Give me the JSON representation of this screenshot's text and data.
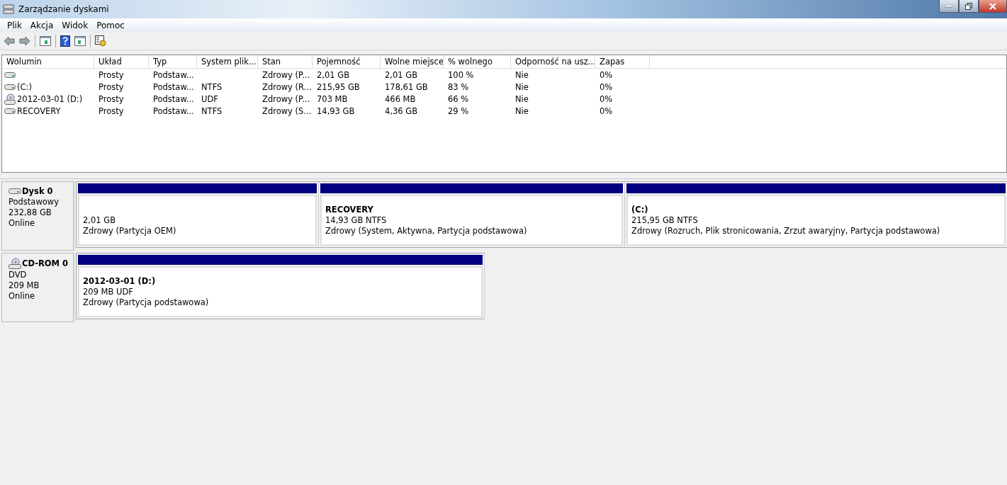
{
  "window": {
    "title": "Zarządzanie dyskami"
  },
  "menu": [
    "Plik",
    "Akcja",
    "Widok",
    "Pomoc"
  ],
  "table": {
    "columns": [
      "Wolumin",
      "Układ",
      "Typ",
      "System plik...",
      "Stan",
      "Pojemność",
      "Wolne miejsce",
      "% wolnego",
      "Odporność na usz...",
      "Zapas"
    ],
    "rows": [
      {
        "kind": "disk",
        "cells": [
          "",
          "Prosty",
          "Podstaw...",
          "",
          "Zdrowy (P...",
          "2,01 GB",
          "2,01 GB",
          "100 %",
          "Nie",
          "0%"
        ]
      },
      {
        "kind": "disk",
        "cells": [
          "(C:)",
          "Prosty",
          "Podstaw...",
          "NTFS",
          "Zdrowy (R...",
          "215,95 GB",
          "178,61 GB",
          "83 %",
          "Nie",
          "0%"
        ]
      },
      {
        "kind": "cd",
        "cells": [
          "2012-03-01 (D:)",
          "Prosty",
          "Podstaw...",
          "UDF",
          "Zdrowy (P...",
          "703 MB",
          "466 MB",
          "66 %",
          "Nie",
          "0%"
        ]
      },
      {
        "kind": "disk",
        "cells": [
          "RECOVERY",
          "Prosty",
          "Podstaw...",
          "NTFS",
          "Zdrowy (S...",
          "14,93 GB",
          "4,36 GB",
          "29 %",
          "Nie",
          "0%"
        ]
      }
    ]
  },
  "disks": [
    {
      "kind": "disk",
      "name": "Dysk 0",
      "type": "Podstawowy",
      "size": "232,88 GB",
      "status": "Online",
      "partitions": [
        {
          "size": "2,01 GB",
          "status": "Zdrowy (Partycja OEM)"
        },
        {
          "name": "RECOVERY",
          "size": "14,93 GB NTFS",
          "status": "Zdrowy (System, Aktywna, Partycja podstawowa)"
        },
        {
          "name": "(C:)",
          "size": "215,95 GB NTFS",
          "status": "Zdrowy (Rozruch, Plik stronicowania, Zrzut awaryjny, Partycja podstawowa)"
        }
      ]
    },
    {
      "kind": "cd",
      "name": "CD-ROM 0",
      "type": "DVD",
      "size": "209 MB",
      "status": "Online",
      "partitions": [
        {
          "name": "2012-03-01  (D:)",
          "size": "209 MB UDF",
          "status": "Zdrowy (Partycja podstawowa)"
        }
      ]
    }
  ]
}
